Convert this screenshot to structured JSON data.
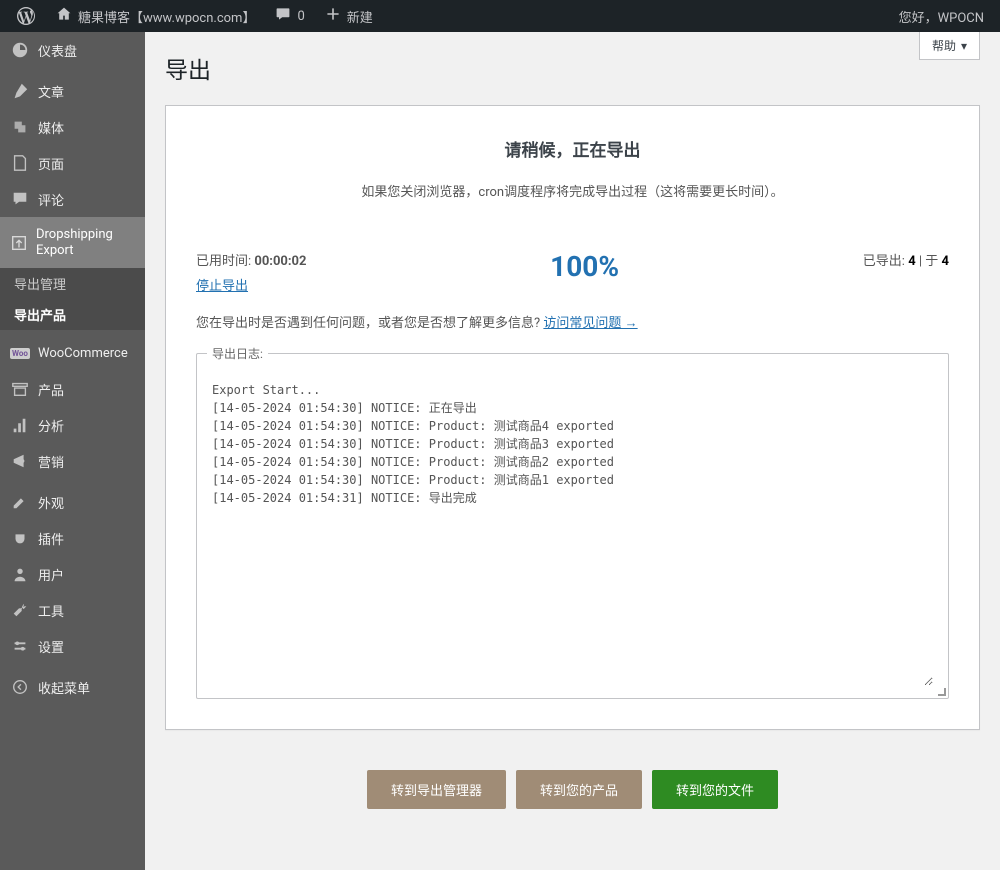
{
  "adminbar": {
    "site_title": "糖果博客【www.wpocn.com】",
    "comment_count": "0",
    "new_label": "新建",
    "greeting": "您好，WPOCN"
  },
  "sidebar": {
    "items": [
      {
        "icon": "dashboard",
        "label": "仪表盘"
      },
      {
        "icon": "pin",
        "label": "文章"
      },
      {
        "icon": "media",
        "label": "媒体"
      },
      {
        "icon": "page",
        "label": "页面"
      },
      {
        "icon": "comment",
        "label": "评论"
      },
      {
        "icon": "export",
        "label": "Dropshipping Export",
        "current": true
      },
      {
        "icon": "woo",
        "label": "WooCommerce"
      },
      {
        "icon": "product",
        "label": "产品"
      },
      {
        "icon": "analytics",
        "label": "分析"
      },
      {
        "icon": "marketing",
        "label": "营销"
      },
      {
        "icon": "appearance",
        "label": "外观"
      },
      {
        "icon": "plugin",
        "label": "插件"
      },
      {
        "icon": "user",
        "label": "用户"
      },
      {
        "icon": "tools",
        "label": "工具"
      },
      {
        "icon": "settings",
        "label": "设置"
      },
      {
        "icon": "collapse",
        "label": "收起菜单"
      }
    ],
    "submenu": [
      {
        "label": "导出管理"
      },
      {
        "label": "导出产品",
        "current": true
      }
    ]
  },
  "content": {
    "help_label": "帮助",
    "page_title": "导出",
    "panel_title": "请稍候，正在导出",
    "panel_note": "如果您关闭浏览器，cron调度程序将完成导出过程（这将需要更长时间）。",
    "elapsed_label": "已用时间:",
    "elapsed_value": "00:00:02",
    "stop_label": "停止导出",
    "percent": "100%",
    "exported_label": "已导出:",
    "exported_count": "4",
    "exported_sep": "| 于",
    "exported_total": "4",
    "faq_prefix": "您在导出时是否遇到任何问题，或者您是否想了解更多信息?",
    "faq_link": "访问常见问题 →",
    "log_label": "导出日志:",
    "log_lines": "Export Start...\n[14-05-2024 01:54:30] NOTICE: 正在导出\n[14-05-2024 01:54:30] NOTICE: Product: 测试商品4 exported\n[14-05-2024 01:54:30] NOTICE: Product: 测试商品3 exported\n[14-05-2024 01:54:30] NOTICE: Product: 测试商品2 exported\n[14-05-2024 01:54:30] NOTICE: Product: 测试商品1 exported\n[14-05-2024 01:54:31] NOTICE: 导出完成",
    "buttons": {
      "manager": "转到导出管理器",
      "products": "转到您的产品",
      "file": "转到您的文件"
    }
  }
}
